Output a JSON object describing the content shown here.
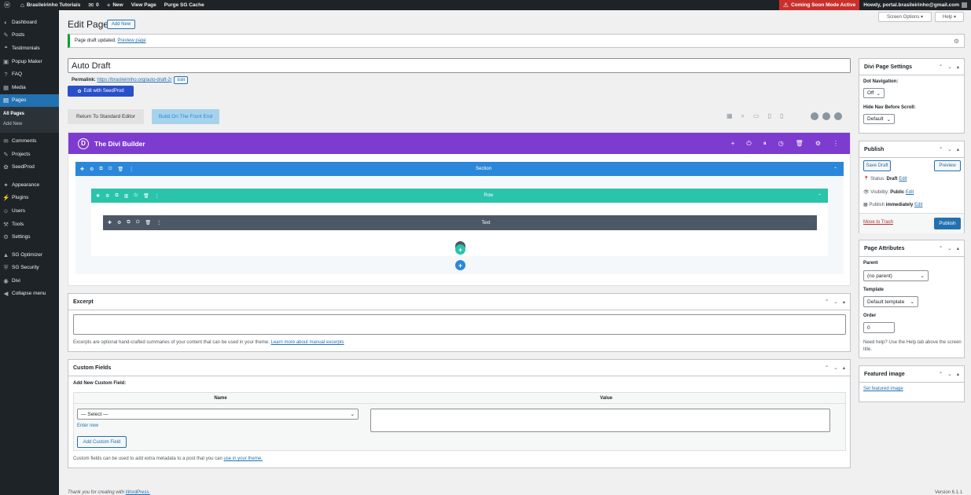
{
  "adminbar": {
    "site": "Brasileirinho Tutoriais",
    "comments": "0",
    "new": "New",
    "view": "View Page",
    "purge": "Purge SG Cache",
    "coming_soon": "Coming Soon Mode Active",
    "howdy": "Howdy, portal.brasileirinho@gmail.com"
  },
  "sidebar": {
    "items": [
      {
        "icon": "dashboard-icon",
        "glyph": "◐",
        "label": "Dashboard"
      },
      {
        "icon": "pin-icon",
        "glyph": "✎",
        "label": "Posts"
      },
      {
        "icon": "quote-icon",
        "glyph": "❝",
        "label": "Testimonials"
      },
      {
        "icon": "popup-icon",
        "glyph": "▣",
        "label": "Popup Maker"
      },
      {
        "icon": "help-icon",
        "glyph": "?",
        "label": "FAQ"
      },
      {
        "icon": "media-icon",
        "glyph": "▦",
        "label": "Media"
      },
      {
        "icon": "pages-icon",
        "glyph": "▤",
        "label": "Pages"
      }
    ],
    "sub": [
      "All Pages",
      "Add New"
    ],
    "items2": [
      {
        "icon": "comments-icon",
        "glyph": "✉",
        "label": "Comments"
      },
      {
        "icon": "projects-icon",
        "glyph": "✎",
        "label": "Projects"
      },
      {
        "icon": "seedprod-icon",
        "glyph": "✿",
        "label": "SeedProd"
      }
    ],
    "items3": [
      {
        "icon": "appearance-icon",
        "glyph": "✦",
        "label": "Appearance"
      },
      {
        "icon": "plugins-icon",
        "glyph": "⚡",
        "label": "Plugins"
      },
      {
        "icon": "users-icon",
        "glyph": "☺",
        "label": "Users"
      },
      {
        "icon": "tools-icon",
        "glyph": "⚒",
        "label": "Tools"
      },
      {
        "icon": "settings-icon",
        "glyph": "⚙",
        "label": "Settings"
      }
    ],
    "items4": [
      {
        "icon": "sg-optimizer-icon",
        "glyph": "▲",
        "label": "SG Optimizer"
      },
      {
        "icon": "sg-security-icon",
        "glyph": "⛨",
        "label": "SG Security"
      },
      {
        "icon": "divi-icon",
        "glyph": "◉",
        "label": "Divi"
      },
      {
        "icon": "collapse-icon",
        "glyph": "◀",
        "label": "Collapse menu"
      }
    ]
  },
  "header": {
    "title": "Edit Page",
    "add_new": "Add New",
    "screen_options": "Screen Options ▾",
    "help": "Help ▾"
  },
  "notice": {
    "text": "Page draft updated.",
    "link": "Preview page"
  },
  "editor": {
    "title_value": "Auto Draft",
    "permalink_label": "Permalink:",
    "permalink_base": "https://brasileirinho.org/",
    "permalink_slug": "auto-draft-2",
    "permalink_end": "/",
    "edit": "Edit",
    "seedprod": "Edit with SeedProd",
    "return_std": "Return To Standard Editor",
    "build_front": "Build On The Front End"
  },
  "divi": {
    "logo": "D",
    "title": "The Divi Builder",
    "section": "Section",
    "row": "Row",
    "module": "Text"
  },
  "excerpt": {
    "title": "Excerpt",
    "help": "Excerpts are optional hand-crafted summaries of your content that can be used in your theme.",
    "link": "Learn more about manual excerpts"
  },
  "custom_fields": {
    "title": "Custom Fields",
    "add_new": "Add New Custom Field:",
    "col_name": "Name",
    "col_value": "Value",
    "select": "— Select —",
    "enter_new": "Enter new",
    "add_button": "Add Custom Field",
    "help": "Custom fields can be used to add extra metadata to a post that you can",
    "help_link": "use in your theme."
  },
  "divi_settings": {
    "title": "Divi Page Settings",
    "dot_nav": "Dot Navigation:",
    "dot_value": "Off",
    "hide_nav": "Hide Nav Before Scroll:",
    "hide_value": "Default"
  },
  "publish": {
    "title": "Publish",
    "save_draft": "Save Draft",
    "preview": "Preview",
    "status_label": "Status:",
    "status": "Draft",
    "visibility_label": "Visibility:",
    "visibility": "Public",
    "publish_label": "Publish",
    "publish_when": "immediately",
    "edit": "Edit",
    "trash": "Move to Trash",
    "publish_btn": "Publish"
  },
  "page_attributes": {
    "title": "Page Attributes",
    "parent_label": "Parent",
    "parent_value": "(no parent)",
    "template_label": "Template",
    "template_value": "Default template",
    "order_label": "Order",
    "order_value": "0",
    "help": "Need help? Use the Help tab above the screen title."
  },
  "featured": {
    "title": "Featured image",
    "link": "Set featured image"
  },
  "footer": {
    "thanks": "Thank you for creating with",
    "wp": "WordPress.",
    "version": "Version 6.1.1"
  },
  "colors": {
    "divi_purple": "#7e3bd0",
    "section_blue": "#2b87da",
    "row_teal": "#29c4a9",
    "module_dark": "#4c5866",
    "wp_blue": "#2271b1"
  }
}
